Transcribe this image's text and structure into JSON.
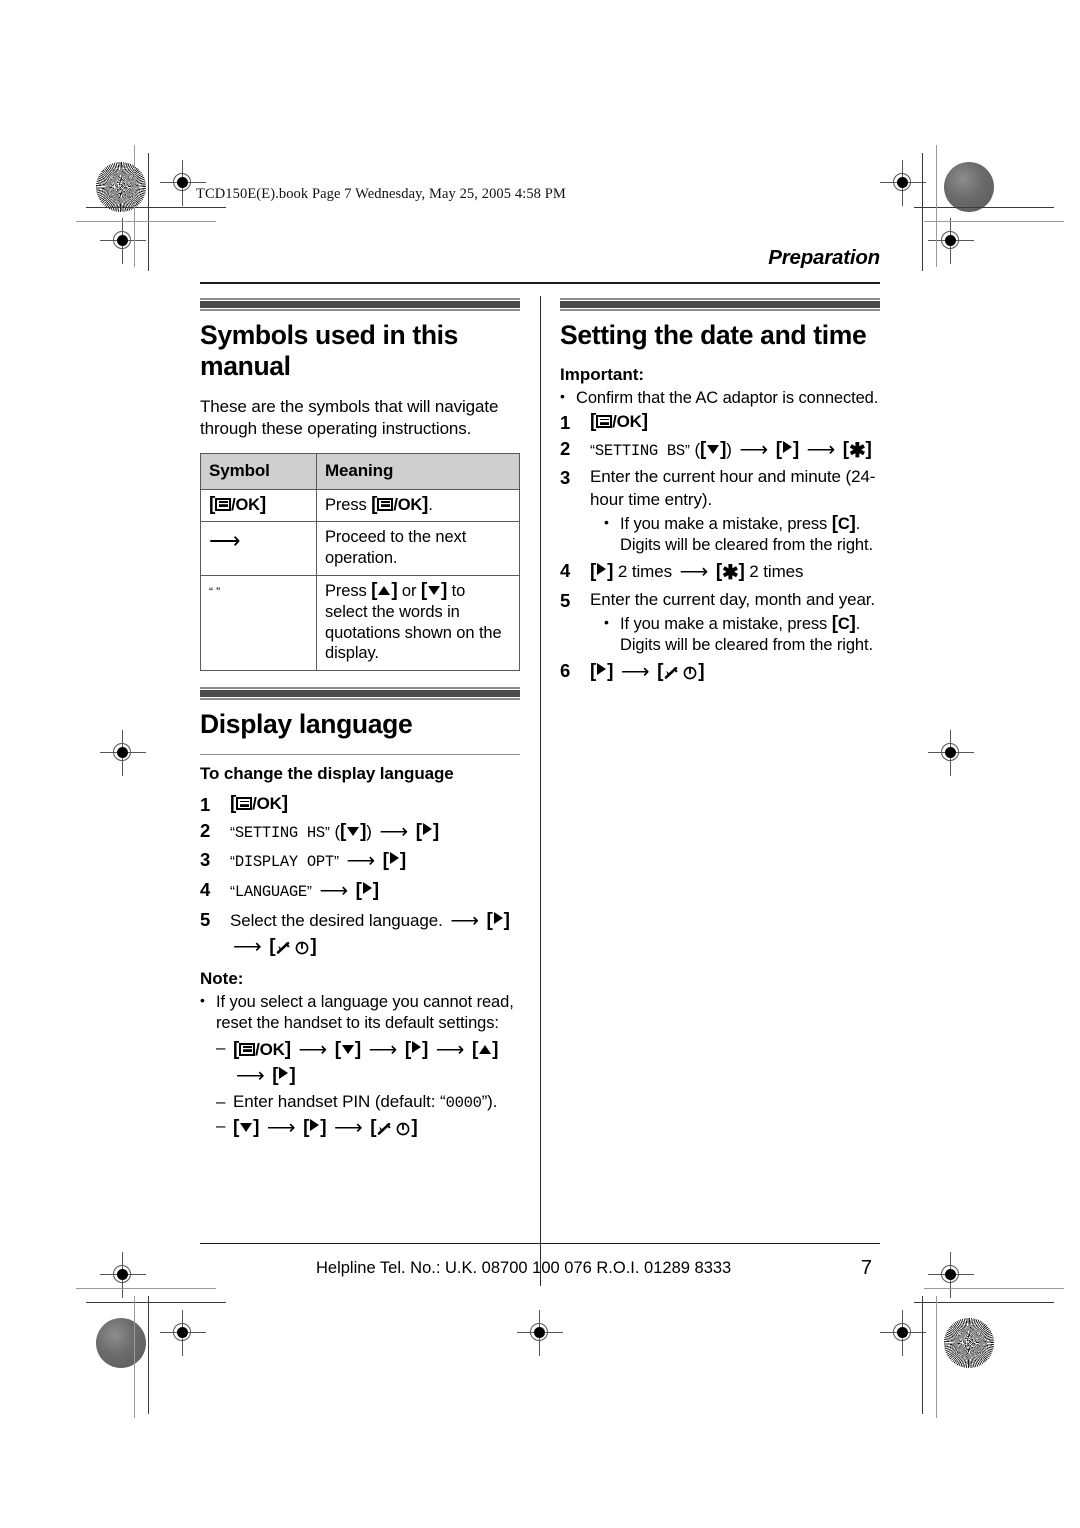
{
  "file_stamp": "TCD150E(E).book  Page 7  Wednesday, May 25, 2005  4:58 PM",
  "running_head": "Preparation",
  "footer": {
    "helpline": "Helpline Tel. No.: U.K. 08700 100 076  R.O.I. 01289 8333",
    "page_number": "7"
  },
  "left_column": {
    "section1": {
      "title": "Symbols used in this manual",
      "intro": "These are the symbols that will navigate through these operating instructions.",
      "table": {
        "headers": [
          "Symbol",
          "Meaning"
        ],
        "rows": [
          {
            "symbol": "[≡/OK]",
            "meaning_pre": "Press ",
            "meaning_key": "[≡/OK]",
            "meaning_post": "."
          },
          {
            "symbol": "→",
            "meaning_pre": "Proceed to the next operation.",
            "meaning_key": "",
            "meaning_post": ""
          },
          {
            "symbol": "“ ”",
            "meaning_pre": "Press ",
            "meaning_key": "[▲] or [▼]",
            "meaning_post": " to select the words in quotations shown on the display."
          }
        ]
      }
    },
    "section2": {
      "title": "Display language",
      "subhead": "To change the display language",
      "steps": [
        {
          "num": "1",
          "text": "[≡/OK]"
        },
        {
          "num": "2",
          "text": "“SETTING HS” ([▼]) → [▶]"
        },
        {
          "num": "3",
          "text": "“DISPLAY OPT” → [▶]"
        },
        {
          "num": "4",
          "text": "“LANGUAGE” → [▶]"
        },
        {
          "num": "5",
          "text": "Select the desired language. → [▶] → [✘ⓞ]"
        }
      ],
      "note_label": "Note:",
      "note_bullet": "If you select a language you cannot read, reset the handset to its default settings:",
      "note_dashes": [
        "[≡/OK] → [▼] → [▶] → [▲] → [▶]",
        "Enter handset PIN (default: “0000”).",
        "[▼] → [▶] → [✘ⓞ]"
      ],
      "pin_default": "0000"
    }
  },
  "right_column": {
    "section1": {
      "title": "Setting the date and time",
      "important_label": "Important:",
      "important_bullet": "Confirm that the AC adaptor is connected.",
      "steps": [
        {
          "num": "1",
          "text": "[≡/OK]"
        },
        {
          "num": "2",
          "text": "“SETTING BS” ([▼]) → [▶] → [∗]"
        },
        {
          "num": "3",
          "text": "Enter the current hour and minute (24-hour time entry)."
        },
        {
          "num": "4",
          "text": "[▶] 2 times → [∗] 2 times"
        },
        {
          "num": "5",
          "text": "Enter the current day, month and year."
        },
        {
          "num": "6",
          "text": "[▶] → [✘ⓞ]"
        }
      ],
      "mistake_bullet_line1": "If you make a mistake, press [C].",
      "mistake_bullet_line2": "Digits will be cleared from the right.",
      "mistake_pre": "If you make a mistake, press ",
      "mistake_key": "[C]",
      "mistake_post": ".",
      "times_label": "2 times",
      "lcd_setting_hs": "SETTING HS",
      "lcd_display_opt": "DISPLAY OPT",
      "lcd_language": "LANGUAGE",
      "lcd_setting_bs": "SETTING BS",
      "step3_text": "Enter the current hour and minute (24-hour time entry).",
      "step5_text": "Enter the current day, month and year."
    }
  },
  "colors": {
    "table_header_bg": "#cfcfcf",
    "rule_dark": "#4a4a4a",
    "rule_light": "#8d8d8d"
  }
}
